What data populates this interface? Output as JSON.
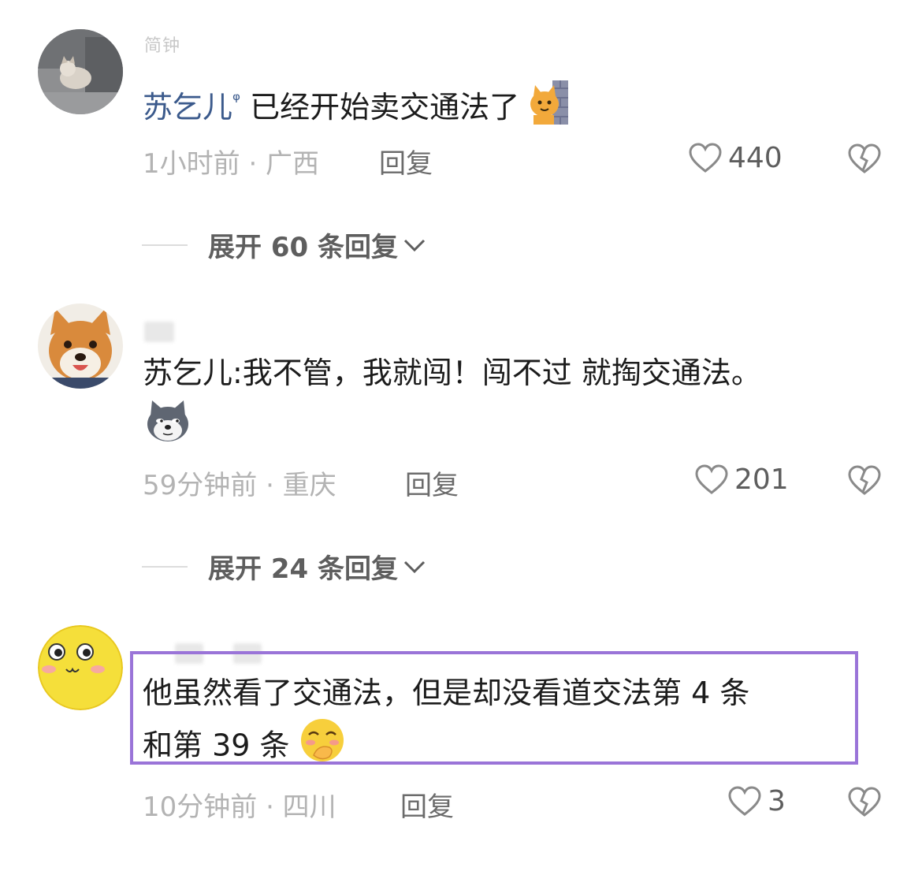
{
  "comments": [
    {
      "username": "简钟",
      "mention": "苏乞儿",
      "text": "已经开始卖交通法了",
      "time_location": "1小时前 · 广西",
      "reply_label": "回复",
      "likes": "440",
      "expand_label": "展开 60 条回复",
      "avatar_icon": "kitten-photo-avatar",
      "emoji_icon": "cat-peeking-wall-emoji"
    },
    {
      "text": "苏乞儿:我不管，我就闯！闯不过 就掏交通法。",
      "time_location": "59分钟前 · 重庆",
      "reply_label": "回复",
      "likes": "201",
      "expand_label": "展开 24 条回复",
      "avatar_icon": "shiba-dog-avatar",
      "emoji_icon": "doge-emoji"
    },
    {
      "text_line1": "他虽然看了交通法，但是却没看道交法第 4 条",
      "text_line2": "和第 39 条",
      "time_location": "10分钟前 · 四川",
      "reply_label": "回复",
      "likes": "3",
      "avatar_icon": "yellow-face-avatar",
      "emoji_icon": "covering-mouth-laugh-emoji"
    }
  ],
  "colors": {
    "mention": "#3b5a8c",
    "highlight": "#9a74d8",
    "meta": "#b3b3b3"
  }
}
